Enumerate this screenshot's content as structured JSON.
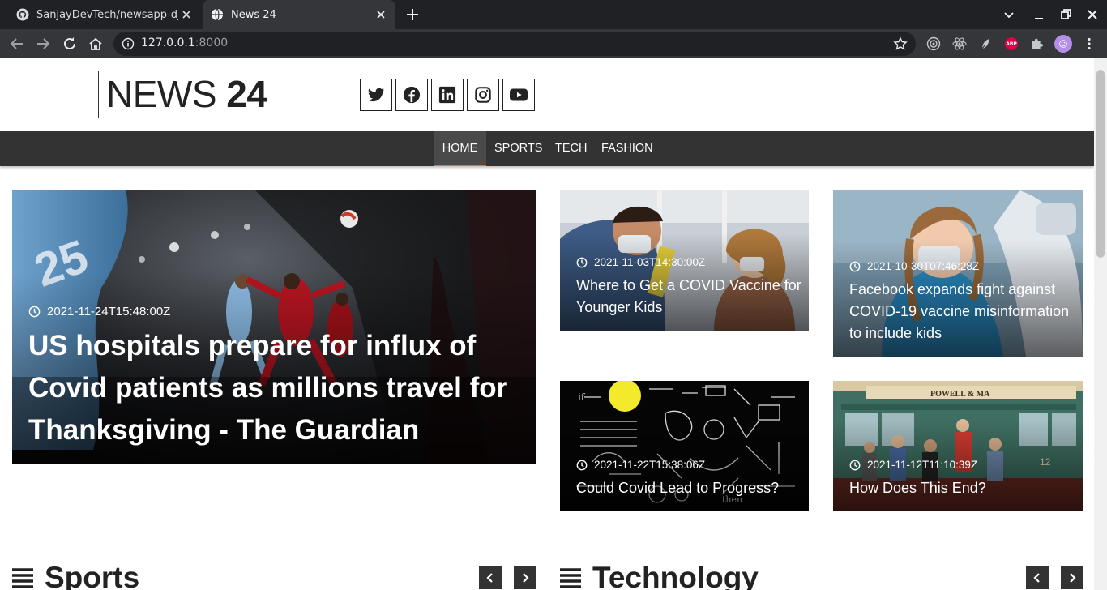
{
  "browser": {
    "tabs": [
      {
        "title": "SanjayDevTech/newsapp-djan",
        "icon": "github-icon",
        "active": false
      },
      {
        "title": "News 24",
        "icon": "globe-icon",
        "active": true
      }
    ],
    "url_host": "127.0.0.1",
    "url_port": ":8000"
  },
  "site": {
    "logo_light": "NEWS ",
    "logo_bold": "24",
    "social": [
      "twitter-icon",
      "facebook-icon",
      "linkedin-icon",
      "instagram-icon",
      "youtube-icon"
    ],
    "nav": [
      "HOME",
      "SPORTS",
      "TECH",
      "FASHION"
    ],
    "nav_active": "HOME",
    "accent": "#d07a3b"
  },
  "featured": {
    "date": "2021-11-24T15:48:00Z",
    "title": "US hospitals prepare for influx of Covid patients as millions travel for Thanksgiving - The Guardian"
  },
  "articles": [
    {
      "date": "2021-11-03T14:30:00Z",
      "title": "Where to Get a COVID Vaccine for Younger Kids"
    },
    {
      "date": "2021-10-30T07:46:28Z",
      "title": "Facebook expands fight against COVID-19 vaccine misinformation to include kids"
    },
    {
      "date": "2021-11-22T15:38:06Z",
      "title": "Could Covid Lead to Progress?"
    },
    {
      "date": "2021-11-12T11:10:39Z",
      "title": "How Does This End?"
    }
  ],
  "sections": {
    "sports": "Sports",
    "technology": "Technology"
  }
}
